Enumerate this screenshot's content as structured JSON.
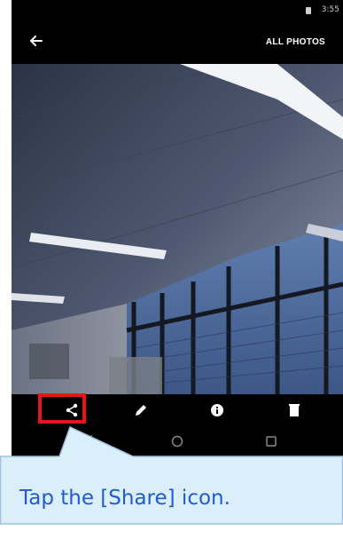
{
  "status_bar": {
    "time": "3:55"
  },
  "toolbar": {
    "all_photos_label": "ALL PHOTOS"
  },
  "action_bar": {
    "items": [
      {
        "icon": "share-icon"
      },
      {
        "icon": "edit-icon"
      },
      {
        "icon": "info-icon"
      },
      {
        "icon": "delete-icon"
      }
    ]
  },
  "nav_bar": {
    "items": [
      "back-icon",
      "home-icon",
      "recents-icon"
    ]
  },
  "callout": {
    "text": "Tap the [Share] icon."
  },
  "colors": {
    "highlight": "#e8141b",
    "callout_text": "#1f5bd6",
    "callout_fill": "#dbeffa",
    "callout_border": "#9cc0e6"
  }
}
